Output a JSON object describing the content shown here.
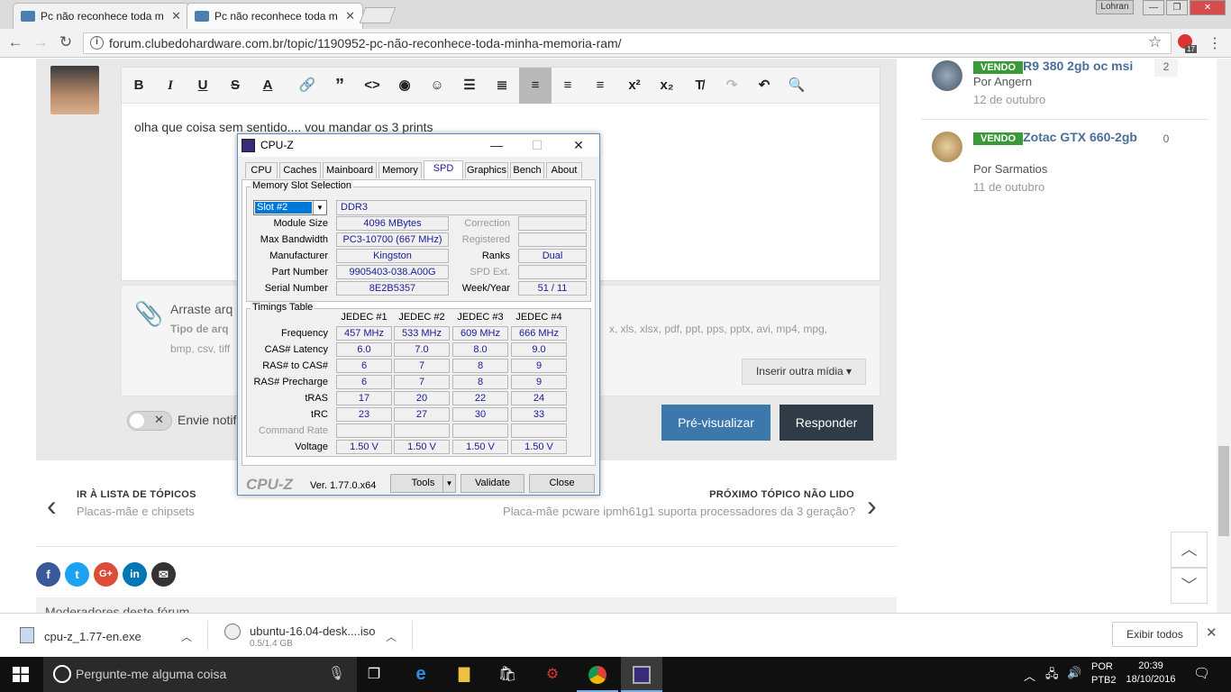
{
  "browser": {
    "tabs": [
      {
        "title": "Pc não reconhece toda m"
      },
      {
        "title": "Pc não reconhece toda m"
      }
    ],
    "user": "Lohran",
    "url": "forum.clubedohardware.com.br/topic/1190952-pc-não-reconhece-toda-minha-memoria-ram/",
    "ext_badge": "17"
  },
  "editor": {
    "text": "olha que coisa sem sentido.... vou mandar os 3 prints",
    "drop_title": "Arraste arq",
    "drop_types_label": "Tipo de arq",
    "drop_types_cont": "x, xls, xlsx, pdf, ppt, pps, pptx, avi, mp4, mpg,",
    "drop_types_line2": "bmp, csv, tiff",
    "insert_media": "Inserir outra mídia ▾",
    "notify": "Envie notif",
    "preview": "Pré-visualizar",
    "reply": "Responder"
  },
  "nav": {
    "prev_title": "IR À LISTA DE TÓPICOS",
    "prev_sub": "Placas-mãe e chipsets",
    "next_title": "PRÓXIMO TÓPICO NÃO LIDO",
    "next_sub": "Placa-mãe pcware ipmh61g1 suporta processadores da 3 geração?"
  },
  "moderators": "Moderadores deste fórum",
  "sidebar": [
    {
      "badge": "VENDO",
      "title": "R9 380 2gb oc msi",
      "by": "Por Angern",
      "date": "12 de outubro",
      "count": "2"
    },
    {
      "badge": "VENDO",
      "title": "Zotac GTX 660-2gb",
      "by": "Por Sarmatios",
      "date": "11 de outubro",
      "count": "0"
    }
  ],
  "cpuz": {
    "title": "CPU-Z",
    "tabs": [
      "CPU",
      "Caches",
      "Mainboard",
      "Memory",
      "SPD",
      "Graphics",
      "Bench",
      "About"
    ],
    "slot_group": "Memory Slot Selection",
    "slot": "Slot #2",
    "type": "DDR3",
    "module_size_label": "Module Size",
    "module_size": "4096 MBytes",
    "max_bw_label": "Max Bandwidth",
    "max_bw": "PC3-10700 (667 MHz)",
    "manufacturer_label": "Manufacturer",
    "manufacturer": "Kingston",
    "part_label": "Part Number",
    "part": "9905403-038.A00G",
    "serial_label": "Serial Number",
    "serial": "8E2B5357",
    "correction_label": "Correction",
    "registered_label": "Registered",
    "ranks_label": "Ranks",
    "ranks": "Dual",
    "spdext_label": "SPD Ext.",
    "weekyear_label": "Week/Year",
    "weekyear": "51 / 11",
    "timings_group": "Timings Table",
    "columns": [
      "JEDEC #1",
      "JEDEC #2",
      "JEDEC #3",
      "JEDEC #4"
    ],
    "rows": [
      {
        "label": "Frequency",
        "values": [
          "457 MHz",
          "533 MHz",
          "609 MHz",
          "666 MHz"
        ]
      },
      {
        "label": "CAS# Latency",
        "values": [
          "6.0",
          "7.0",
          "8.0",
          "9.0"
        ]
      },
      {
        "label": "RAS# to CAS#",
        "values": [
          "6",
          "7",
          "8",
          "9"
        ]
      },
      {
        "label": "RAS# Precharge",
        "values": [
          "6",
          "7",
          "8",
          "9"
        ]
      },
      {
        "label": "tRAS",
        "values": [
          "17",
          "20",
          "22",
          "24"
        ]
      },
      {
        "label": "tRC",
        "values": [
          "23",
          "27",
          "30",
          "33"
        ]
      },
      {
        "label": "Command Rate",
        "values": [
          "",
          "",
          "",
          ""
        ]
      },
      {
        "label": "Voltage",
        "values": [
          "1.50 V",
          "1.50 V",
          "1.50 V",
          "1.50 V"
        ]
      }
    ],
    "logo": "CPU-Z",
    "version": "Ver. 1.77.0.x64",
    "tools": "Tools",
    "validate": "Validate",
    "close": "Close"
  },
  "downloads": [
    {
      "name": "cpu-z_1.77-en.exe",
      "sub": ""
    },
    {
      "name": "ubuntu-16.04-desk....iso",
      "sub": "0.5/1.4 GB"
    }
  ],
  "show_all": "Exibir todos",
  "taskbar": {
    "search": "Pergunte-me alguma coisa",
    "lang1": "POR",
    "lang2": "PTB2",
    "time": "20:39",
    "date": "18/10/2016"
  },
  "colors": {
    "accent": "#3d78ad",
    "reply": "#2f3b46",
    "badge": "#3a9a3a",
    "cpuz_value": "#1a1a9a"
  }
}
